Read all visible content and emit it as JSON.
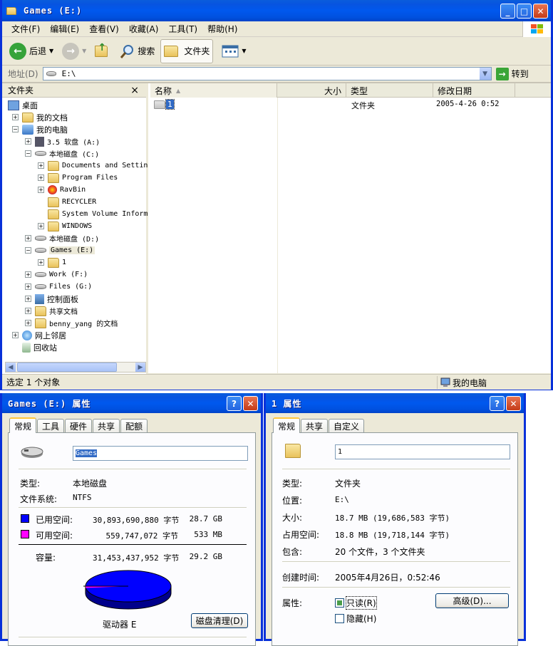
{
  "explorer": {
    "title": "Games (E:)",
    "menu": [
      "文件(F)",
      "编辑(E)",
      "查看(V)",
      "收藏(A)",
      "工具(T)",
      "帮助(H)"
    ],
    "toolbar": {
      "back": "后退",
      "search": "搜索",
      "folders": "文件夹"
    },
    "address": {
      "label": "地址(D)",
      "value": "E:\\",
      "go": "转到"
    },
    "tree": {
      "header": "文件夹",
      "close": "×",
      "nodes": [
        {
          "label": "桌面",
          "expander": ""
        },
        {
          "label": "我的文档",
          "expander": "+"
        },
        {
          "label": "我的电脑",
          "expander": "−"
        },
        {
          "label": "3.5 软盘 (A:)",
          "expander": "+"
        },
        {
          "label": "本地磁盘 (C:)",
          "expander": "−"
        },
        {
          "label": "Documents and Settin",
          "expander": "+"
        },
        {
          "label": "Program Files",
          "expander": "+"
        },
        {
          "label": "RavBin",
          "expander": "+"
        },
        {
          "label": "RECYCLER",
          "expander": ""
        },
        {
          "label": "System Volume Inform",
          "expander": ""
        },
        {
          "label": "WINDOWS",
          "expander": "+"
        },
        {
          "label": "本地磁盘 (D:)",
          "expander": "+"
        },
        {
          "label": "Games (E:)",
          "expander": "−"
        },
        {
          "label": "1",
          "expander": "+"
        },
        {
          "label": "Work (F:)",
          "expander": "+"
        },
        {
          "label": "Files (G:)",
          "expander": "+"
        },
        {
          "label": "控制面板",
          "expander": "+"
        },
        {
          "label": "共享文档",
          "expander": "+"
        },
        {
          "label": "benny_yang 的文档",
          "expander": "+"
        },
        {
          "label": "网上邻居",
          "expander": "+"
        },
        {
          "label": "回收站",
          "expander": ""
        }
      ]
    },
    "columns": {
      "name": "名称",
      "size": "大小",
      "type": "类型",
      "modified": "修改日期"
    },
    "files": [
      {
        "name": "1",
        "size": "",
        "type": "文件夹",
        "modified": "2005-4-26 0:52"
      }
    ],
    "status": {
      "left": "选定 1 个对象",
      "right": "我的电脑"
    }
  },
  "drive_props": {
    "title": "Games (E:) 属性",
    "tabs": [
      "常规",
      "工具",
      "硬件",
      "共享",
      "配额"
    ],
    "name": "Games",
    "type_label": "类型:",
    "type_value": "本地磁盘",
    "fs_label": "文件系统:",
    "fs_value": "NTFS",
    "used_label": "已用空间:",
    "used_bytes": "30,893,690,880 字节",
    "used_size": "28.7 GB",
    "free_label": "可用空间:",
    "free_bytes": "559,747,072 字节",
    "free_size": "533 MB",
    "cap_label": "容量:",
    "cap_bytes": "31,453,437,952 字节",
    "cap_size": "29.2 GB",
    "drive_label": "驱动器 E",
    "cleanup": "磁盘清理(D)",
    "used_color": "#0000ff",
    "free_color": "#ff00ff",
    "used_fraction": 0.982
  },
  "folder_props": {
    "title": "1 属性",
    "tabs": [
      "常规",
      "共享",
      "自定义"
    ],
    "name": "1",
    "type_label": "类型:",
    "type_value": "文件夹",
    "loc_label": "位置:",
    "loc_value": "E:\\",
    "size_label": "大小:",
    "size_value": "18.7 MB (19,686,583 字节)",
    "disk_label": "占用空间:",
    "disk_value": "18.8 MB (19,718,144 字节)",
    "contains_label": "包含:",
    "contains_value": "20 个文件，3 个文件夹",
    "created_label": "创建时间:",
    "created_value": "2005年4月26日，0:52:46",
    "attr_label": "属性:",
    "readonly": "只读(R)",
    "hidden": "隐藏(H)",
    "advanced": "高级(D)..."
  }
}
